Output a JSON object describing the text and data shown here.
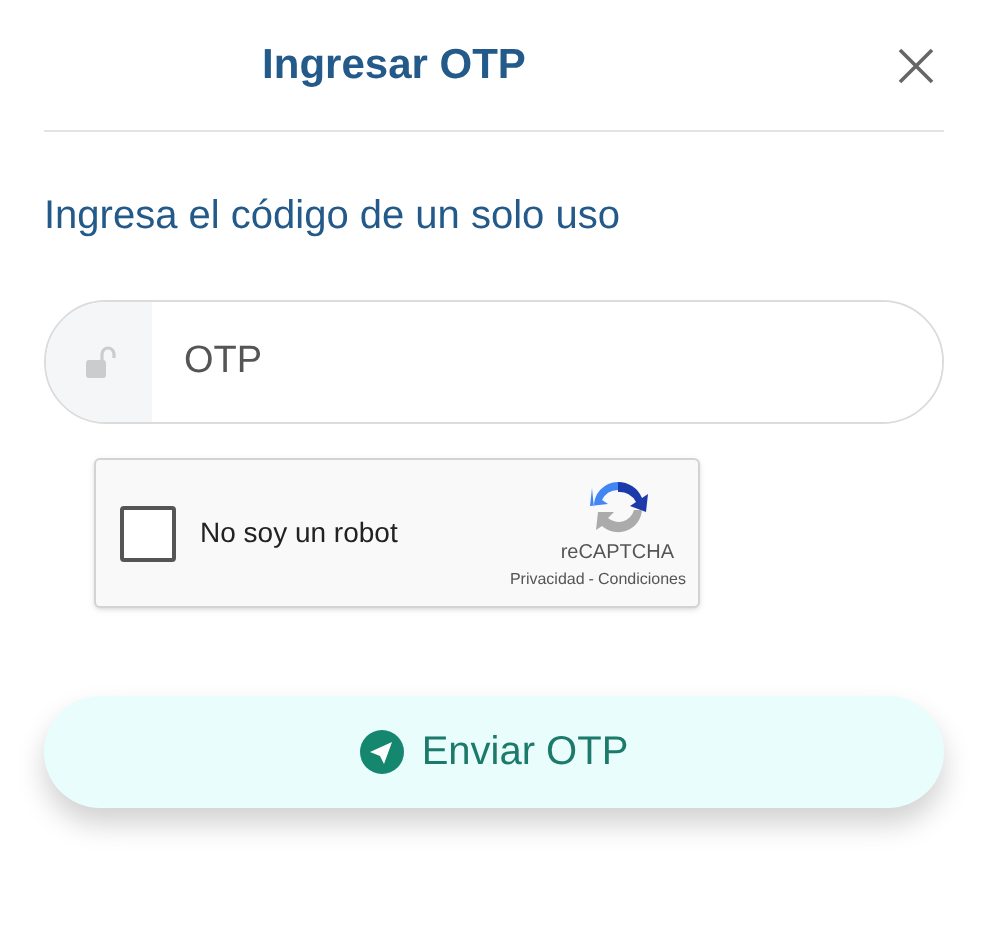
{
  "dialog": {
    "title": "Ingresar OTP"
  },
  "prompt": "Ingresa el código de un solo uso",
  "otp_field": {
    "placeholder": "OTP"
  },
  "captcha": {
    "label": "No soy un robot",
    "checked": false,
    "brand": "reCAPTCHA",
    "privacy": "Privacidad",
    "separator": "-",
    "terms": "Condiciones"
  },
  "submit": {
    "label": "Enviar OTP"
  }
}
